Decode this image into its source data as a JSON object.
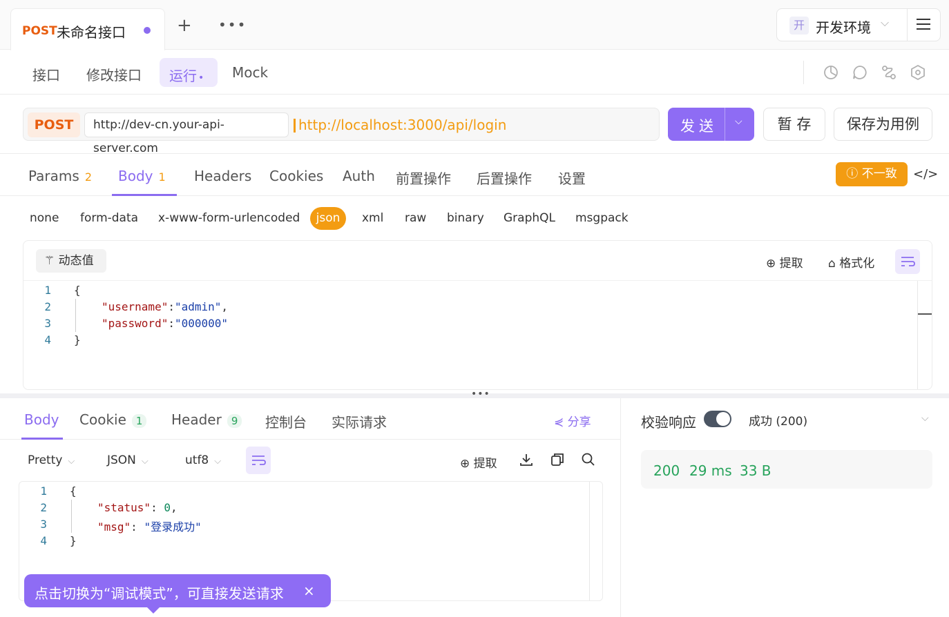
{
  "tab": {
    "method": "POST",
    "name": "未命名接口",
    "plus": "+",
    "more": "•••"
  },
  "env": {
    "badge": "开",
    "label": "开发环境"
  },
  "subnav": {
    "items": [
      "接口",
      "修改接口",
      "运行",
      "Mock"
    ],
    "run_dot": "•"
  },
  "url": {
    "method": "POST",
    "base": "http://dev-cn.your-api-server.com",
    "path": "http://localhost:3000/api/login"
  },
  "actions": {
    "send": "发送",
    "save_temp": "暂 存",
    "save_case": "保存为用例"
  },
  "request_tabs": [
    {
      "label": "Params",
      "count": "2"
    },
    {
      "label": "Body",
      "count": "1"
    },
    {
      "label": "Headers",
      "count": ""
    },
    {
      "label": "Cookies",
      "count": ""
    },
    {
      "label": "Auth",
      "count": ""
    },
    {
      "label": "前置操作",
      "count": ""
    },
    {
      "label": "后置操作",
      "count": ""
    },
    {
      "label": "设置",
      "count": ""
    }
  ],
  "mismatch": "不一致",
  "code_icon": "</>",
  "body_types": [
    "none",
    "form-data",
    "x-www-form-urlencoded",
    "json",
    "xml",
    "raw",
    "binary",
    "GraphQL",
    "msgpack"
  ],
  "request_editor": {
    "dynamic_button": "动态值",
    "extract": "提取",
    "format": "格式化",
    "lines": [
      {
        "n": "1",
        "text": "{"
      },
      {
        "n": "2",
        "key": "\"username\"",
        "sep": ":",
        "val": "\"admin\"",
        "tail": ","
      },
      {
        "n": "3",
        "key": "\"password\"",
        "sep": ":",
        "val": "\"000000\"",
        "tail": ""
      },
      {
        "n": "4",
        "text": "}"
      }
    ]
  },
  "splitter": "•••",
  "response_tabs": [
    {
      "label": "Body",
      "count": ""
    },
    {
      "label": "Cookie",
      "count": "1"
    },
    {
      "label": "Header",
      "count": "9"
    },
    {
      "label": "控制台",
      "count": ""
    },
    {
      "label": "实际请求",
      "count": ""
    }
  ],
  "share": "分享",
  "response_options": {
    "view": "Pretty",
    "format": "JSON",
    "encoding": "utf8",
    "extract": "提取"
  },
  "response_editor": {
    "lines": [
      {
        "n": "1",
        "text": "{"
      },
      {
        "n": "2",
        "key": "\"status\"",
        "sep": ": ",
        "val": "0",
        "tail": ","
      },
      {
        "n": "3",
        "key": "\"msg\"",
        "sep": ": ",
        "val": "\"登录成功\"",
        "tail": ""
      },
      {
        "n": "4",
        "text": "}"
      }
    ]
  },
  "validation": {
    "label": "校验响应",
    "enabled": true,
    "result": "成功 (200)"
  },
  "metrics": {
    "status": "200",
    "time": "29 ms",
    "size": "33 B"
  },
  "tooltip": {
    "text": "点击切换为“调试模式”，可直接发送请求",
    "close": "×"
  },
  "colors": {
    "accent": "#8e6cf4",
    "method": "#e85d0f",
    "orange": "#f39c12",
    "success": "#27a35b"
  }
}
